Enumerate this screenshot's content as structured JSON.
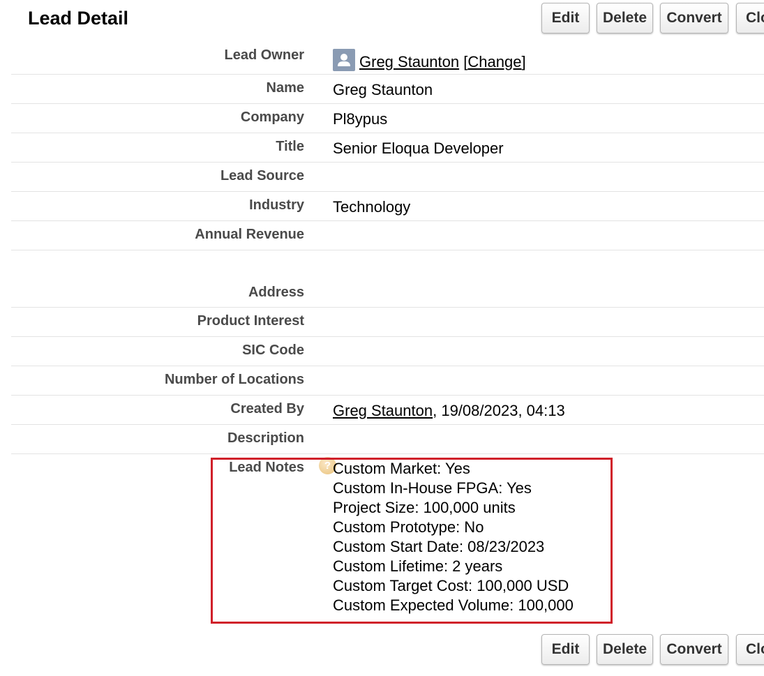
{
  "header": {
    "title": "Lead Detail"
  },
  "buttons": {
    "edit": "Edit",
    "delete": "Delete",
    "convert": "Convert",
    "clone": "Clone"
  },
  "fields": {
    "lead_owner": {
      "label": "Lead Owner",
      "name": "Greg Staunton",
      "change_open": "[",
      "change": "Change",
      "change_close": "]"
    },
    "name": {
      "label": "Name",
      "value": "Greg Staunton"
    },
    "company": {
      "label": "Company",
      "value": "Pl8ypus"
    },
    "title": {
      "label": "Title",
      "value": "Senior Eloqua Developer"
    },
    "lead_source": {
      "label": "Lead Source",
      "value": ""
    },
    "industry": {
      "label": "Industry",
      "value": "Technology"
    },
    "annual_revenue": {
      "label": "Annual Revenue",
      "value": ""
    },
    "address": {
      "label": "Address",
      "value": ""
    },
    "product_interest": {
      "label": "Product Interest",
      "value": ""
    },
    "sic_code": {
      "label": "SIC Code",
      "value": ""
    },
    "number_of_locations": {
      "label": "Number of Locations",
      "value": ""
    },
    "created_by": {
      "label": "Created By",
      "name": "Greg Staunton",
      "datetime": ", 19/08/2023, 04:13"
    },
    "description": {
      "label": "Description",
      "value": ""
    },
    "lead_notes": {
      "label": "Lead Notes",
      "help_glyph": "?",
      "lines": [
        "Custom Market: Yes",
        "Custom In-House FPGA: Yes",
        "Project Size: 100,000 units",
        "Custom Prototype: No",
        "Custom Start Date: 08/23/2023",
        "Custom Lifetime: 2 years",
        "Custom Target Cost: 100,000 USD",
        "Custom Expected Volume: 100,000"
      ]
    }
  },
  "colors": {
    "highlight_border": "#d0202a",
    "label_text": "#4a4a4a",
    "divider": "#e3e3e3"
  },
  "icons": {
    "owner_avatar": "user-avatar-icon",
    "help": "help-icon"
  }
}
